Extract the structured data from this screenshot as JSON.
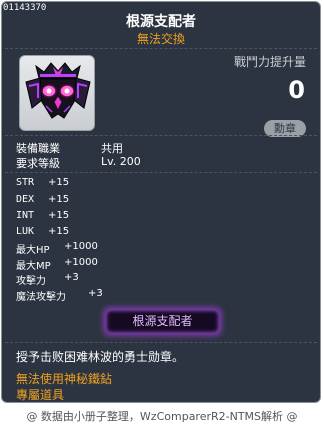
{
  "item_id": "01143370",
  "title": "根源支配者",
  "subtitle": "無法交換",
  "power": {
    "label": "戰鬥力提升量",
    "value": "0",
    "badge": "勳章"
  },
  "requirements": [
    {
      "label": "裝備職業",
      "value": "共用"
    },
    {
      "label": "要求等級",
      "value": "Lv. 200"
    }
  ],
  "stats": [
    {
      "name": "STR",
      "value": "+15"
    },
    {
      "name": "DEX",
      "value": "+15"
    },
    {
      "name": "INT",
      "value": "+15"
    },
    {
      "name": "LUK",
      "value": "+15"
    },
    {
      "name": "最大HP",
      "value": "+1000"
    },
    {
      "name": "最大MP",
      "value": "+1000"
    },
    {
      "name": "攻擊力",
      "value": "+3"
    },
    {
      "name": "魔法攻擊力",
      "value": "+3"
    }
  ],
  "set_badge": "根源支配者",
  "description": "授予击败困难林波的勇士勋章。",
  "notes": [
    "無法使用神秘鐵鉆",
    "專屬道具"
  ],
  "footer": "@ 数据由小册子整理，WzComparerR2-NTMS解析 @",
  "colors": {
    "panel": "#2b3440",
    "warning": "#f0a020",
    "set_glow": "#7a3aa8"
  },
  "icon": "dark-crown-medal-icon"
}
